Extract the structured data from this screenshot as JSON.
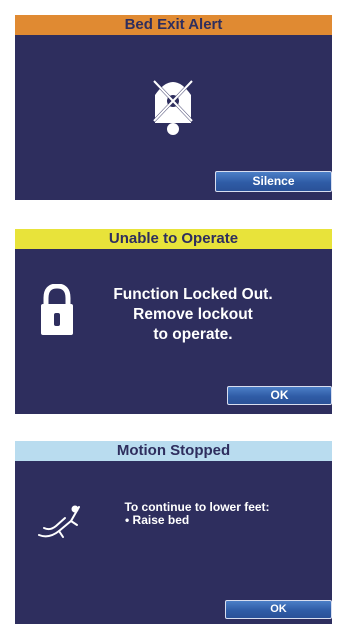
{
  "panels": {
    "bed_exit": {
      "title": "Bed Exit Alert",
      "header_color": "#e08a32",
      "icon": "bed-exit-alarm-icon",
      "button_label": "Silence"
    },
    "unable": {
      "title": "Unable to Operate",
      "header_color": "#e8e33a",
      "icon": "lock-icon",
      "message_lines": [
        "Function Locked Out.",
        "Remove lockout",
        "to operate."
      ],
      "button_label": "OK"
    },
    "motion": {
      "title": "Motion Stopped",
      "header_color": "#b9dcef",
      "icon": "patient-recline-icon",
      "message_lines": [
        "To continue to lower feet:",
        "• Raise bed"
      ],
      "button_label": "OK"
    }
  },
  "colors": {
    "panel_background": "#2e2e5e",
    "button_blue": "#3a67b3"
  }
}
